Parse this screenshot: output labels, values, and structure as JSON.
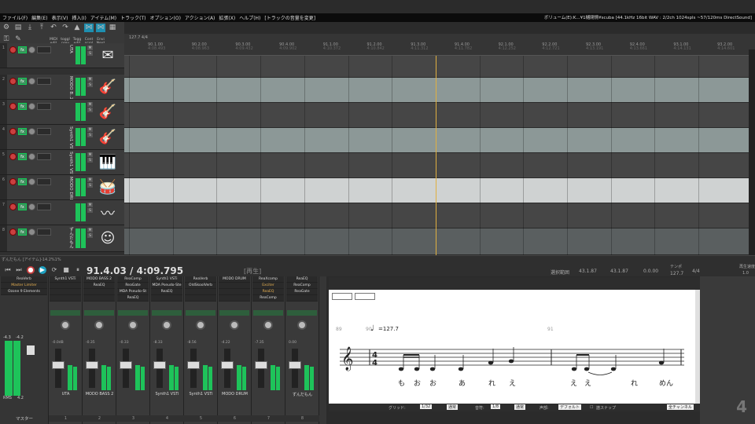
{
  "menu": {
    "items": [
      "ファイル(F)",
      "編集(E)",
      "表示(V)",
      "挿入(I)",
      "アイテム(M)",
      "トラック(T)",
      "オプション(O)",
      "アクション(A)",
      "拡張(X)",
      "ヘルプ(H)",
      "[トラックの音量を変更]"
    ],
    "status": "ボリューム(E):K...¥1樋閉情¥scuba [44.1kHz 16bit WAV : 2/2ch 1024spls ~57/120ms DirectSound]"
  },
  "toolbar": {
    "labels": [
      "MIDI edit",
      "toggl prev",
      "Togg edit",
      "Cont scrol",
      "Envi Next"
    ]
  },
  "ruler": {
    "tempo": "127.7 4/4",
    "marks": [
      {
        "bar": "90.1.00",
        "time": "4:08.493"
      },
      {
        "bar": "90.2.00",
        "time": "4:08.963"
      },
      {
        "bar": "90.3.00",
        "time": "4:09.432"
      },
      {
        "bar": "90.4.00",
        "time": "4:09.902"
      },
      {
        "bar": "91.1.00",
        "time": "4:10.372"
      },
      {
        "bar": "91.2.00",
        "time": "4:10.842"
      },
      {
        "bar": "91.3.00",
        "time": "4:11.312"
      },
      {
        "bar": "91.4.00",
        "time": "4:11.782"
      },
      {
        "bar": "92.1.00",
        "time": "4:12.252"
      },
      {
        "bar": "92.2.00",
        "time": "4:12.721"
      },
      {
        "bar": "92.3.00",
        "time": "4:13.191"
      },
      {
        "bar": "92.4.00",
        "time": "4:13.661"
      },
      {
        "bar": "93.1.00",
        "time": "4:14.131"
      },
      {
        "bar": "93.2.00",
        "time": "4:14.601"
      }
    ]
  },
  "tracks": [
    {
      "num": "1",
      "name": "UTA",
      "icon": "✉"
    },
    {
      "num": "2",
      "name": "MODO B..2",
      "icon": "🎸"
    },
    {
      "num": "3",
      "name": "",
      "icon": "🎸"
    },
    {
      "num": "4",
      "name": "Synth1 VSTi",
      "icon": "🎸"
    },
    {
      "num": "5",
      "name": "Synth1 VSTi",
      "icon": "🎹"
    },
    {
      "num": "6",
      "name": "MODO DRL",
      "icon": "🥁"
    },
    {
      "num": "7",
      "name": "",
      "icon": "〰"
    },
    {
      "num": "8",
      "name": "ずんだもん",
      "icon": "☺"
    }
  ],
  "transport": {
    "track_sel": "ずんだもん [アイテム]-14.2%1%",
    "position": "91.4.03 / 4:09.795",
    "state": "[再生]",
    "sel_label": "選択範囲",
    "sel_start": "43.1.87",
    "sel_end": "43.1.87",
    "sel_len": "0.0.00",
    "tempo_label": "テンポ",
    "tempo": "127.7",
    "sig": "4/4",
    "rate_label": "再生速度",
    "rate": "1.0"
  },
  "master": {
    "fx": [
      "ReaVerb",
      "Master Limiter",
      "Ozone 9 Elements"
    ],
    "label": "マスター",
    "rms": "RMS",
    "rms_val": "4.2",
    "peak_l": "-4.3",
    "peak_r": "-4.2"
  },
  "channels": [
    {
      "name": "UTA",
      "num": "1",
      "fx": [
        "Synth1 VSTi",
        "",
        "",
        ""
      ],
      "db": "-0.0dB"
    },
    {
      "name": "MODO BASS 2",
      "num": "2",
      "fx": [
        "MODO BASS 2",
        "ReaEQ",
        "",
        ""
      ],
      "db": "-0.35"
    },
    {
      "name": "",
      "num": "3",
      "fx": [
        "ReaComp",
        "ReaGate",
        "MDA Pseudo-St",
        "ReaEQ"
      ],
      "db": "-0.33"
    },
    {
      "name": "Synth1 VSTi",
      "num": "4",
      "fx": [
        "Synth1 VSTi",
        "MDA Pseudo-Ste",
        "ReaEQ",
        ""
      ],
      "db": "-8.33"
    },
    {
      "name": "Synth1 VSTi",
      "num": "5",
      "fx": [
        "ReaVerb",
        "OldSkoolVerb",
        "",
        ""
      ],
      "db": "-8.56"
    },
    {
      "name": "MODO DRUM",
      "num": "6",
      "fx": [
        "MODO DRUM",
        "",
        "",
        ""
      ],
      "db": "-4.22"
    },
    {
      "name": "",
      "num": "7",
      "fx": [
        "ReaXcomp",
        "Exciter",
        "ReaEQ",
        "ReaComp"
      ],
      "db": "-7.35"
    },
    {
      "name": "ずんだもん",
      "num": "8",
      "fx": [
        "ReaEQ",
        "ReaComp",
        "ReaGate",
        ""
      ],
      "db": "0.00"
    }
  ],
  "score": {
    "tempo_text": "=127.7",
    "bar_89": "89",
    "bar_90": "90",
    "bar_91": "91",
    "lyrics": [
      "も",
      "お",
      "お",
      "あ",
      "れ",
      "え",
      "え",
      "え",
      "れ",
      "めん"
    ]
  },
  "score_bottom": {
    "grid_label": "グリッド:",
    "grid": "1/32",
    "normal1": "通常",
    "length_label": "音符:",
    "length": "1/8",
    "normal2": "通常",
    "voice_label": "声部:",
    "voice": "デフォルト",
    "snap": "譜スナップ",
    "channel": "全チャンネル"
  },
  "right": {
    "big": "4"
  }
}
